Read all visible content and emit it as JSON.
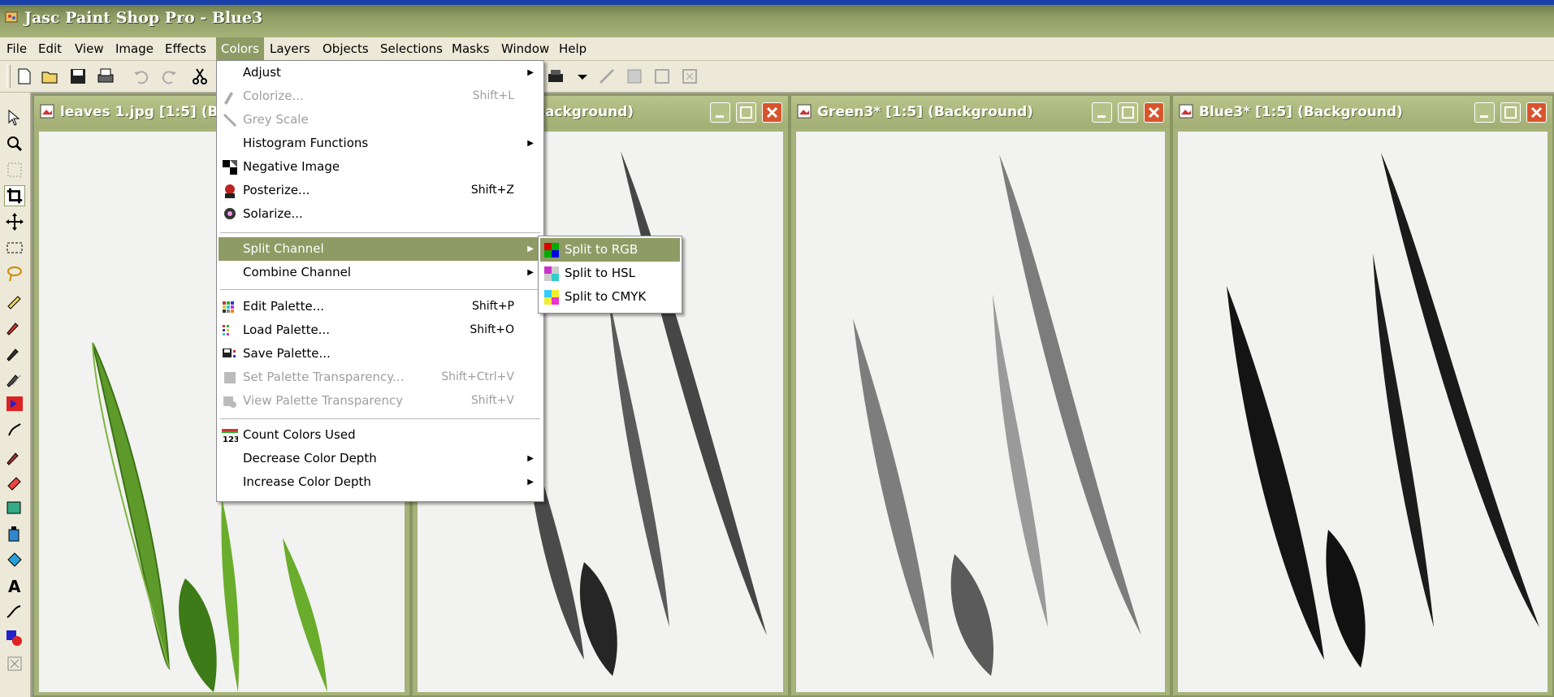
{
  "window_title": "Jasc Paint Shop Pro - Blue3",
  "menubar": [
    "File",
    "Edit",
    "View",
    "Image",
    "Effects",
    "Colors",
    "Layers",
    "Objects",
    "Selections",
    "Masks",
    "Window",
    "Help"
  ],
  "docs": [
    {
      "title": "leaves 1.jpg [1:5] (B"
    },
    {
      "title": "Background)"
    },
    {
      "title": "Green3* [1:5] (Background)"
    },
    {
      "title": "Blue3* [1:5] (Background)"
    }
  ],
  "colors_menu": {
    "adjust": "Adjust",
    "colorize": "Colorize...",
    "colorize_sc": "Shift+L",
    "grey_scale": "Grey Scale",
    "histogram": "Histogram Functions",
    "negative": "Negative Image",
    "posterize": "Posterize...",
    "posterize_sc": "Shift+Z",
    "solarize": "Solarize...",
    "split_channel": "Split Channel",
    "combine_channel": "Combine Channel",
    "edit_palette": "Edit Palette...",
    "edit_palette_sc": "Shift+P",
    "load_palette": "Load Palette...",
    "load_palette_sc": "Shift+O",
    "save_palette": "Save Palette...",
    "set_palette_transparency": "Set Palette Transparency...",
    "set_palette_transparency_sc": "Shift+Ctrl+V",
    "view_palette_transparency": "View Palette Transparency",
    "view_palette_transparency_sc": "Shift+V",
    "count_colors": "Count Colors Used",
    "decrease_depth": "Decrease Color Depth",
    "increase_depth": "Increase Color Depth"
  },
  "split_submenu": [
    "Split to RGB",
    "Split to HSL",
    "Split to CMYK"
  ],
  "colors": {
    "accent": "#8f9b64",
    "title_bar": "#a7b27a",
    "close_button": "#d8542d"
  }
}
